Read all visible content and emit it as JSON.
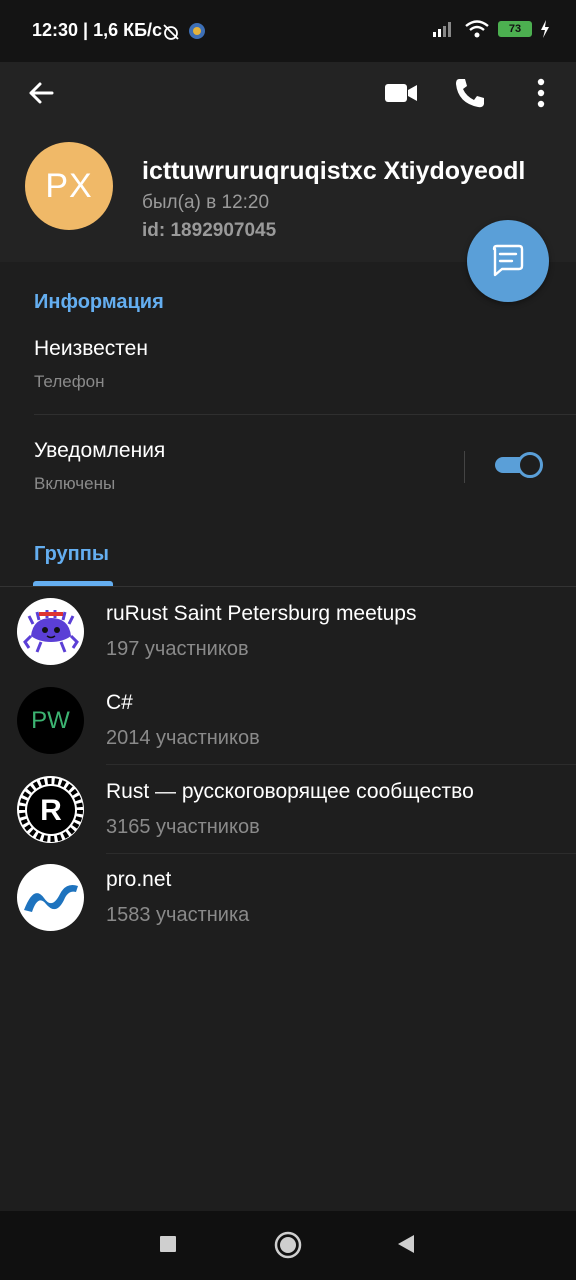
{
  "status": {
    "time": "12:30 | 1,6 КБ/с",
    "battery": "73"
  },
  "profile": {
    "initials": "PX",
    "avatar_color": "#f0b968",
    "name": "icttuwruruqruqistxc Xtiydoyeodl",
    "last_seen": "был(а) в 12:20",
    "user_id": "id: 1892907045"
  },
  "info": {
    "section_title": "Информация",
    "phone_value": "Неизвестен",
    "phone_label": "Телефон",
    "notifications_title": "Уведомления",
    "notifications_status": "Включены",
    "notifications_enabled": true
  },
  "groups": {
    "tab_title": "Группы",
    "items": [
      {
        "name": "ruRust Saint Petersburg meetups",
        "members": "197 участников",
        "avatar": "ferris-crab-icon"
      },
      {
        "name": "C#",
        "members": "2014 участников",
        "avatar_text": "PW",
        "avatar": "pw-logo"
      },
      {
        "name": "Rust — русскоговорящее сообщество",
        "members": "3165 участников",
        "avatar": "rust-logo-icon"
      },
      {
        "name": "pro.net",
        "members": "1583 участника",
        "avatar": "dotnet-logo-icon"
      }
    ]
  },
  "colors": {
    "accent": "#64aef0",
    "fab": "#5a9fd8",
    "background": "#1e1e1e"
  }
}
